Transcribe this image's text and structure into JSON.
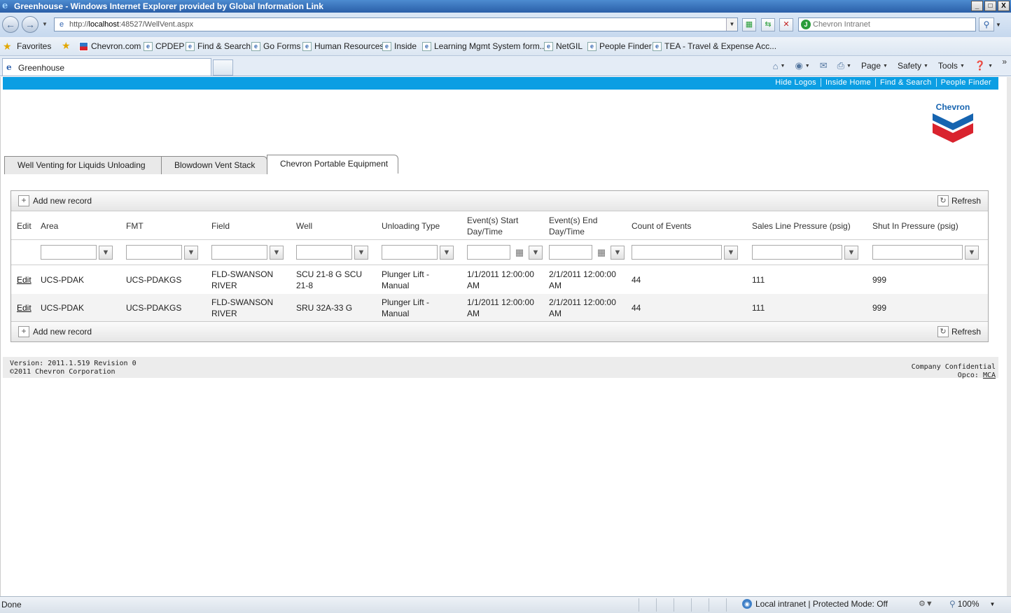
{
  "window": {
    "title": "Greenhouse - Windows Internet Explorer provided by Global Information Link",
    "controls": [
      "_",
      "□",
      "X"
    ]
  },
  "address_bar": {
    "url_prefix": "http://",
    "url_host": "localhost",
    "url_rest": ":48527/WellVent.aspx",
    "search_placeholder": "Chevron Intranet"
  },
  "favorites": {
    "label": "Favorites",
    "links": [
      "Chevron.com",
      "CPDEP",
      "Find & Search",
      "Go Forms",
      "Human Resources",
      "Inside",
      "Learning Mgmt System form...",
      "NetGIL",
      "People Finder",
      "TEA - Travel & Expense Acc..."
    ]
  },
  "browser_tab": {
    "title": "Greenhouse"
  },
  "command_bar": {
    "page": "Page",
    "safety": "Safety",
    "tools": "Tools"
  },
  "top_links": [
    "Hide Logos",
    "Inside Home",
    "Find & Search",
    "People Finder"
  ],
  "logo": {
    "text": "Chevron"
  },
  "app_tabs": [
    {
      "label": "Well Venting for Liquids Unloading",
      "active": false
    },
    {
      "label": "Blowdown Vent Stack",
      "active": false
    },
    {
      "label": "Chevron Portable Equipment",
      "active": true
    }
  ],
  "grid": {
    "add_label": "Add new record",
    "refresh_label": "Refresh",
    "columns": [
      "Edit",
      "Area",
      "FMT",
      "Field",
      "Well",
      "Unloading Type",
      "Event(s) Start Day/Time",
      "Event(s) End Day/Time",
      "Count of Events",
      "Sales Line Pressure (psig)",
      "Shut In Pressure (psig)"
    ],
    "rows": [
      {
        "edit": "Edit",
        "area": "UCS-PDAK",
        "fmt": "UCS-PDAKGS",
        "field": "FLD-SWANSON RIVER",
        "well": "SCU 21-8 G SCU 21-8",
        "unloading_type": "Plunger Lift - Manual",
        "start": "1/1/2011 12:00:00 AM",
        "end": "2/1/2011 12:00:00 AM",
        "count": "44",
        "sales_pressure": "111",
        "shut_in_pressure": "999"
      },
      {
        "edit": "Edit",
        "area": "UCS-PDAK",
        "fmt": "UCS-PDAKGS",
        "field": "FLD-SWANSON RIVER",
        "well": "SRU 32A-33 G",
        "unloading_type": "Plunger Lift - Manual",
        "start": "1/1/2011 12:00:00 AM",
        "end": "2/1/2011 12:00:00 AM",
        "count": "44",
        "sales_pressure": "111",
        "shut_in_pressure": "999"
      }
    ]
  },
  "footer": {
    "version": "Version: 2011.1.519 Revision 0",
    "copyright": "©2011 Chevron Corporation",
    "confidential": "Company Confidential",
    "opco_label": "Opco:",
    "opco_value": "MCA"
  },
  "status_bar": {
    "status": "Done",
    "zone": "Local intranet | Protected Mode: Off",
    "zoom": "100%"
  },
  "colors": {
    "accent_bar": "#0b9ee3",
    "chevron_blue": "#1664b0",
    "chevron_red": "#d9232e"
  }
}
